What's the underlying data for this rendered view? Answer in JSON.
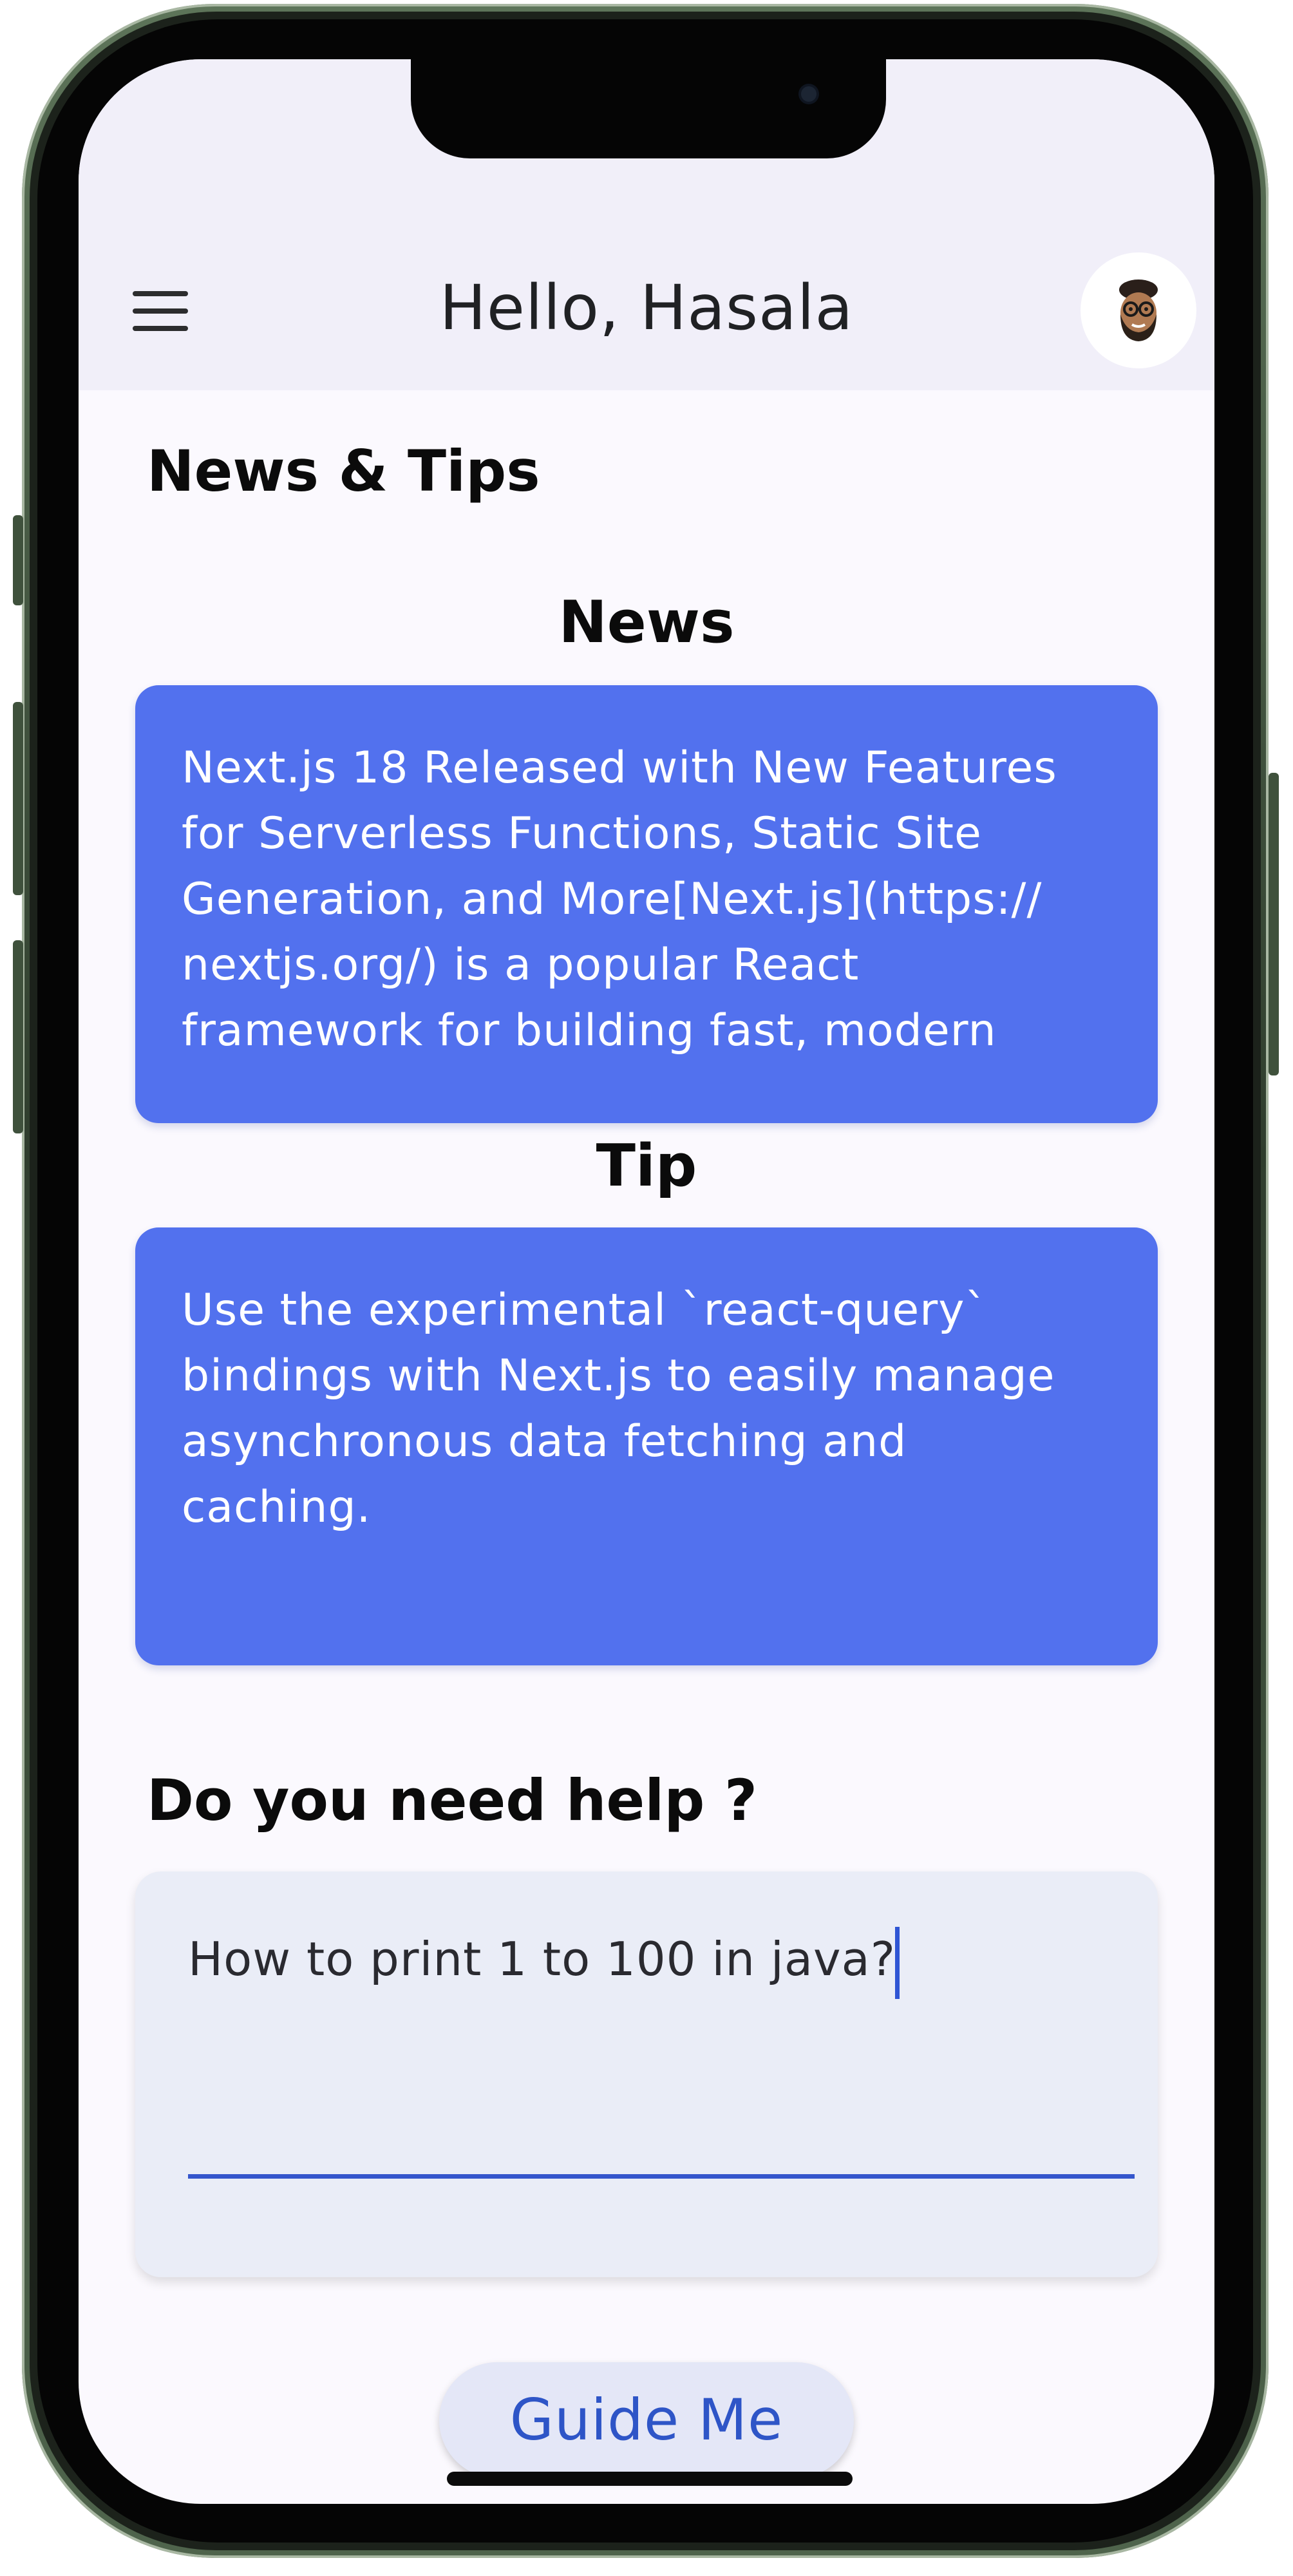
{
  "header": {
    "greeting": "Hello, Hasala",
    "menu_icon": "hamburger-menu-icon",
    "avatar_icon": "memoji-avatar"
  },
  "page": {
    "title": "News & Tips"
  },
  "news": {
    "heading": "News",
    "body": "Next.js 18 Released with New Features\nfor Serverless Functions, Static Site\nGeneration, and More[Next.js](https://\nnextjs.org/) is a popular React\nframework for building fast, modern"
  },
  "tip": {
    "heading": "Tip",
    "body": "Use the experimental `react-query`\nbindings with Next.js to easily manage\nasynchronous data fetching and\ncaching."
  },
  "help": {
    "heading": "Do you need help ?",
    "input_value": "How to print 1 to 100 in java?",
    "button_label": "Guide Me"
  },
  "colors": {
    "card": "#5271ee",
    "accent": "#3556cc",
    "header_bg": "#f1eff9",
    "frame": "#4f644c"
  }
}
